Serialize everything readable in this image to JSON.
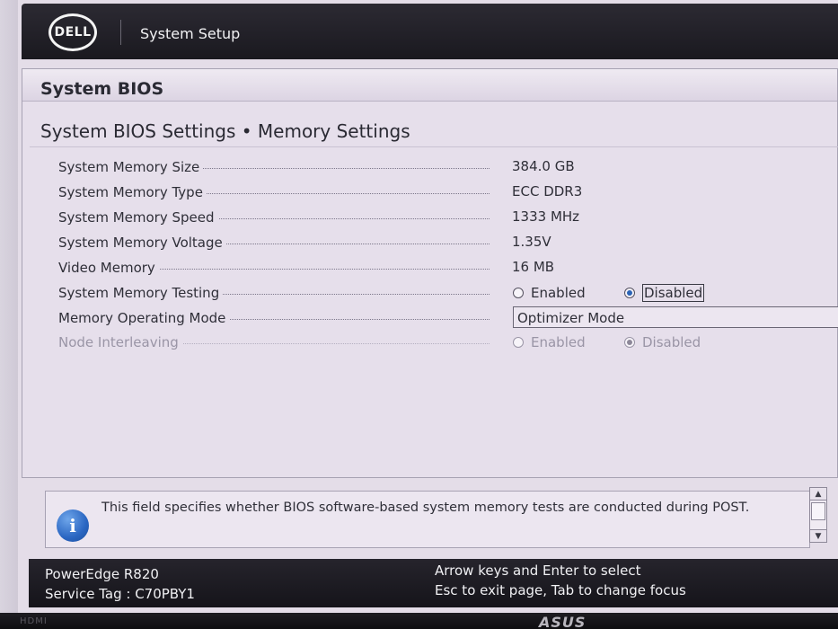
{
  "header": {
    "logo_text": "DELL",
    "title": "System Setup"
  },
  "panel": {
    "title": "System BIOS",
    "page_title": "System BIOS Settings • Memory Settings"
  },
  "rows": [
    {
      "label": "System Memory Size",
      "value": "384.0 GB"
    },
    {
      "label": "System Memory Type",
      "value": "ECC DDR3"
    },
    {
      "label": "System Memory Speed",
      "value": "1333 MHz"
    },
    {
      "label": "System Memory Voltage",
      "value": "1.35V"
    },
    {
      "label": "Video Memory",
      "value": "16 MB"
    },
    {
      "label": "System Memory Testing",
      "options": [
        "Enabled",
        "Disabled"
      ],
      "selected": "Disabled"
    },
    {
      "label": "Memory Operating Mode",
      "value": "Optimizer Mode"
    },
    {
      "label": "Node Interleaving",
      "options": [
        "Enabled",
        "Disabled"
      ],
      "selected": "Disabled",
      "disabled": true
    }
  ],
  "help": {
    "text": "This field specifies whether BIOS software-based system memory tests are conducted during POST."
  },
  "footer": {
    "model": "PowerEdge R820",
    "service_tag": "Service Tag : C70PBY1",
    "hint1": "Arrow keys and Enter to select",
    "hint2": "Esc to exit page, Tab to change focus"
  },
  "bezel": {
    "port_label": "HDMI",
    "brand": "ASUS"
  },
  "colors": {
    "header_bg": "#1a191f",
    "panel_bg": "#e6dfeb",
    "radio_checked": "#2b63b5",
    "info_icon": "#2a66c2"
  },
  "icons": {
    "info": "info-icon",
    "logo": "dell-logo"
  }
}
